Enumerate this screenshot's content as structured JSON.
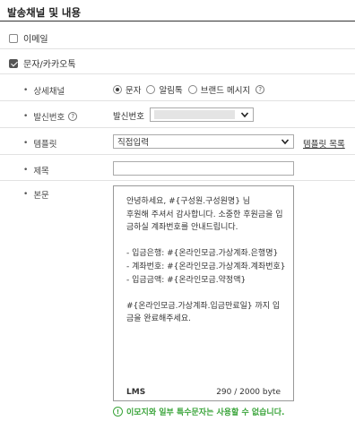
{
  "section": {
    "title": "발송채널 및 내용"
  },
  "channels": {
    "email": {
      "label": "이메일",
      "checked": false
    },
    "sms_kakao": {
      "label": "문자/카카오톡",
      "checked": true
    }
  },
  "fields": {
    "detail_channel": {
      "label": "상세채널",
      "options": [
        {
          "label": "문자",
          "selected": true
        },
        {
          "label": "알림톡",
          "selected": false
        },
        {
          "label": "브랜드 메시지",
          "selected": false
        }
      ]
    },
    "sender_number": {
      "label": "발신번호",
      "inner_label": "발신번호",
      "value": ""
    },
    "template": {
      "label": "템플릿",
      "value": "직접입력",
      "list_link": "템플릿 목록"
    },
    "subject": {
      "label": "제목",
      "value": ""
    },
    "body": {
      "label": "본문",
      "text": "안녕하세요, #{구성원.구성원명} 님\n후원해 주셔서 감사합니다. 소중한 후원금을 입금하실 계좌번호를 안내드립니다.\n\n- 입금은행: #{온라인모금.가상계좌.은행명}\n- 계좌번호: #{온라인모금.가상계좌.계좌번호}\n- 입금금액: #{온라인모금.약정액}\n\n#{온라인모금.가상계좌.입금만료일} 까지 입금을 완료해주세요.",
      "type": "LMS",
      "byte_count": "290 / 2000 byte"
    }
  },
  "notice": {
    "text": "이모지와 일부 특수문자는 사용할 수 없습니다."
  },
  "icons": {
    "help": "question-circle-icon",
    "chevron": "chevron-down-icon",
    "notice": "exclamation-circle-icon"
  },
  "colors": {
    "notice": "#3aa43a",
    "title_rule": "#333333"
  }
}
